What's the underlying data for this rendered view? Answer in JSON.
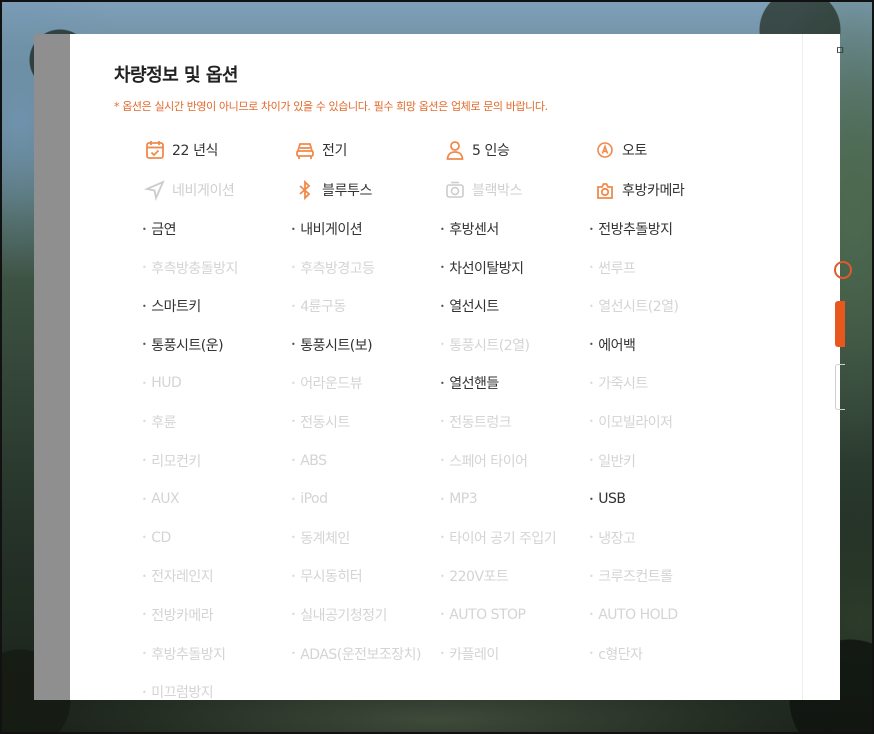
{
  "title": "차량정보 및 옵션",
  "notice": "* 옵션은 실시간 반영이 아니므로 차이가 있을 수 있습니다. 필수 희망 옵션은 업체로 문의 바랍니다.",
  "right_panel": {
    "dot": "ㅁ"
  },
  "specs": [
    {
      "label": "22 년식",
      "icon": "calendar-check-icon",
      "active": true
    },
    {
      "label": "전기",
      "icon": "car-front-icon",
      "active": true
    },
    {
      "label": "5 인승",
      "icon": "person-icon",
      "active": true
    },
    {
      "label": "오토",
      "icon": "auto-transmission-icon",
      "active": true
    },
    {
      "label": "네비게이션",
      "icon": "navigation-icon",
      "active": false
    },
    {
      "label": "블루투스",
      "icon": "bluetooth-icon",
      "active": true
    },
    {
      "label": "블랙박스",
      "icon": "dashcam-icon",
      "active": false
    },
    {
      "label": "후방카메라",
      "icon": "rear-camera-icon",
      "active": true
    }
  ],
  "options": [
    {
      "label": "금연",
      "active": true
    },
    {
      "label": "내비게이션",
      "active": true
    },
    {
      "label": "후방센서",
      "active": true
    },
    {
      "label": "전방추돌방지",
      "active": true
    },
    {
      "label": "후측방충돌방지",
      "active": false
    },
    {
      "label": "후측방경고등",
      "active": false
    },
    {
      "label": "차선이탈방지",
      "active": true
    },
    {
      "label": "썬루프",
      "active": false
    },
    {
      "label": "스마트키",
      "active": true
    },
    {
      "label": "4륜구동",
      "active": false
    },
    {
      "label": "열선시트",
      "active": true
    },
    {
      "label": "열선시트(2열)",
      "active": false
    },
    {
      "label": "통풍시트(운)",
      "active": true
    },
    {
      "label": "통풍시트(보)",
      "active": true
    },
    {
      "label": "통풍시트(2열)",
      "active": false
    },
    {
      "label": "에어백",
      "active": true
    },
    {
      "label": "HUD",
      "active": false
    },
    {
      "label": "어라운드뷰",
      "active": false
    },
    {
      "label": "열선핸들",
      "active": true
    },
    {
      "label": "가죽시트",
      "active": false
    },
    {
      "label": "후륜",
      "active": false
    },
    {
      "label": "전동시트",
      "active": false
    },
    {
      "label": "전동트렁크",
      "active": false
    },
    {
      "label": "이모빌라이저",
      "active": false
    },
    {
      "label": "리모컨키",
      "active": false
    },
    {
      "label": "ABS",
      "active": false
    },
    {
      "label": "스페어 타이어",
      "active": false
    },
    {
      "label": "일반키",
      "active": false
    },
    {
      "label": "AUX",
      "active": false
    },
    {
      "label": "iPod",
      "active": false
    },
    {
      "label": "MP3",
      "active": false
    },
    {
      "label": "USB",
      "active": true
    },
    {
      "label": "CD",
      "active": false
    },
    {
      "label": "동계체인",
      "active": false
    },
    {
      "label": "타이어 공기 주입기",
      "active": false
    },
    {
      "label": "냉장고",
      "active": false
    },
    {
      "label": "전자레인지",
      "active": false
    },
    {
      "label": "무시동히터",
      "active": false
    },
    {
      "label": "220V포트",
      "active": false
    },
    {
      "label": "크루즈컨트롤",
      "active": false
    },
    {
      "label": "전방카메라",
      "active": false
    },
    {
      "label": "실내공기청정기",
      "active": false
    },
    {
      "label": "AUTO STOP",
      "active": false
    },
    {
      "label": "AUTO HOLD",
      "active": false
    },
    {
      "label": "후방추돌방지",
      "active": false
    },
    {
      "label": "ADAS(운전보조장치)",
      "active": false
    },
    {
      "label": "카플레이",
      "active": false
    },
    {
      "label": "c형단자",
      "active": false
    },
    {
      "label": "미끄럼방지",
      "active": false
    }
  ],
  "colors": {
    "accent": "#f08a4b",
    "notice": "#e26a2c",
    "active_text": "#333333",
    "inactive_text": "#d4d4d4"
  }
}
